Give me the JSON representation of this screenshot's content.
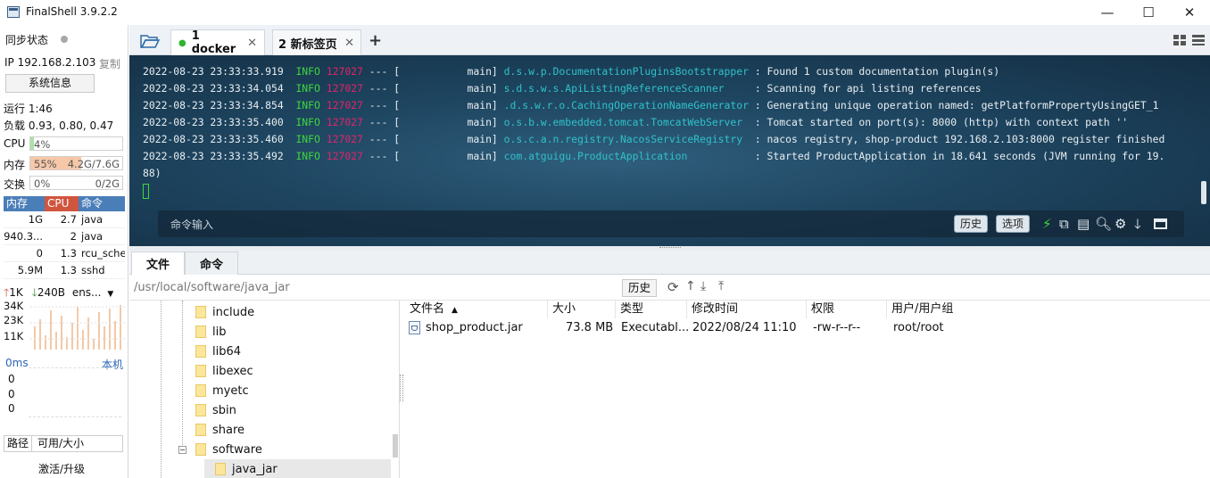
{
  "window": {
    "title": "FinalShell 3.9.2.2",
    "controls": {
      "minimize": "—",
      "maximize": "☐",
      "close": "✕"
    }
  },
  "sidebar": {
    "sync_status": "同步状态",
    "ip": "IP 192.168.2.103",
    "copy": "复制",
    "sysinfo": "系统信息",
    "uptime": "运行 1:46",
    "load": "负载 0.93, 0.80, 0.47",
    "cpu": {
      "label": "CPU",
      "percent": "4%",
      "fill": 4
    },
    "mem": {
      "label": "内存",
      "percent": "55%",
      "detail": "4.2G/7.6G",
      "fill": 55
    },
    "swap": {
      "label": "交换",
      "percent": "0%",
      "detail": "0/2G",
      "fill": 0
    },
    "proc_headers": [
      "内存",
      "CPU",
      "命令"
    ],
    "procs": [
      {
        "mem": "1G",
        "cpu": "2.7",
        "cmd": "java"
      },
      {
        "mem": "940.3...",
        "cpu": "2",
        "cmd": "java"
      },
      {
        "mem": "0",
        "cpu": "1.3",
        "cmd": "rcu_sche"
      },
      {
        "mem": "5.9M",
        "cpu": "1.3",
        "cmd": "sshd"
      }
    ],
    "net": {
      "up": "1K",
      "down": "240B",
      "iface": "ens...",
      "y_labels": [
        "34K",
        "23K",
        "11K"
      ]
    },
    "ping": {
      "value": "0ms",
      "host": "本机",
      "rows": [
        "0",
        "0",
        "0"
      ]
    },
    "disk_headers": [
      "路径",
      "可用/大小"
    ],
    "activate": "激活/升级"
  },
  "tabs": [
    {
      "label": "1 docker",
      "status_color": "#2db52d",
      "active": true
    },
    {
      "label": "2 新标签页",
      "active": false
    }
  ],
  "terminal": {
    "lines": [
      {
        "ts": "2022-08-23 23:33:33.919",
        "level": "INFO",
        "pid": "127027",
        "sep": "---",
        "thread": "[           main]",
        "logger": "d.s.w.p.DocumentationPluginsBootstrapper",
        "msg": ": Found 1 custom documentation plugin(s)"
      },
      {
        "ts": "2022-08-23 23:33:34.054",
        "level": "INFO",
        "pid": "127027",
        "sep": "---",
        "thread": "[           main]",
        "logger": "s.d.s.w.s.ApiListingReferenceScanner    ",
        "msg": ": Scanning for api listing references"
      },
      {
        "ts": "2022-08-23 23:33:34.854",
        "level": "INFO",
        "pid": "127027",
        "sep": "---",
        "thread": "[           main]",
        "logger": ".d.s.w.r.o.CachingOperationNameGenerator",
        "msg": ": Generating unique operation named: getPlatformPropertyUsingGET_1"
      },
      {
        "ts": "2022-08-23 23:33:35.400",
        "level": "INFO",
        "pid": "127027",
        "sep": "---",
        "thread": "[           main]",
        "logger": "o.s.b.w.embedded.tomcat.TomcatWebServer ",
        "msg": ": Tomcat started on port(s): 8000 (http) with context path ''"
      },
      {
        "ts": "2022-08-23 23:33:35.460",
        "level": "INFO",
        "pid": "127027",
        "sep": "---",
        "thread": "[           main]",
        "logger": "o.s.c.a.n.registry.NacosServiceRegistry ",
        "msg": ": nacos registry, shop-product 192.168.2.103:8000 register finished"
      },
      {
        "ts": "2022-08-23 23:33:35.492",
        "level": "INFO",
        "pid": "127027",
        "sep": "---",
        "thread": "[           main]",
        "logger": "com.atguigu.ProductApplication          ",
        "msg": ": Started ProductApplication in 18.641 seconds (JVM running for 19."
      }
    ],
    "wrap": "88)",
    "cmd_placeholder": "命令输入",
    "history": "历史",
    "options": "选项"
  },
  "sftp": {
    "tabs": [
      "文件",
      "命令"
    ],
    "path": "/usr/local/software/java_jar",
    "history": "历史",
    "tree": [
      "include",
      "lib",
      "lib64",
      "libexec",
      "myetc",
      "sbin",
      "share",
      "software",
      "java_jar"
    ],
    "columns": [
      "文件名",
      "大小",
      "类型",
      "修改时间",
      "权限",
      "用户/用户组"
    ],
    "files": [
      {
        "name": "shop_product.jar",
        "size": "73.8 MB",
        "type": "Executabl...",
        "mtime": "2022/08/24 11:10",
        "perm": "-rw-r--r--",
        "owner": "root/root"
      }
    ]
  }
}
